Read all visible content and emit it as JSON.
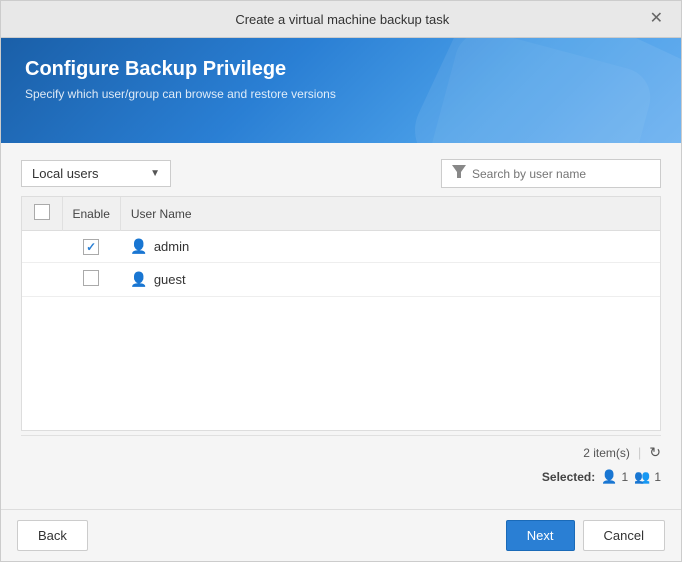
{
  "dialog": {
    "title": "Create a virtual machine backup task",
    "header": {
      "title": "Configure Backup Privilege",
      "subtitle": "Specify which user/group can browse and restore versions"
    }
  },
  "toolbar": {
    "dropdown_label": "Local users",
    "search_placeholder": "Search by user name"
  },
  "table": {
    "columns": [
      {
        "id": "enable",
        "label": "Enable"
      },
      {
        "id": "username",
        "label": "User Name"
      }
    ],
    "rows": [
      {
        "id": 1,
        "enabled": true,
        "username": "admin"
      },
      {
        "id": 2,
        "enabled": false,
        "username": "guest"
      }
    ]
  },
  "footer": {
    "item_count": "2 item(s)",
    "selected_label": "Selected:",
    "user_single_count": "1",
    "user_group_count": "1"
  },
  "buttons": {
    "back": "Back",
    "next": "Next",
    "cancel": "Cancel"
  }
}
